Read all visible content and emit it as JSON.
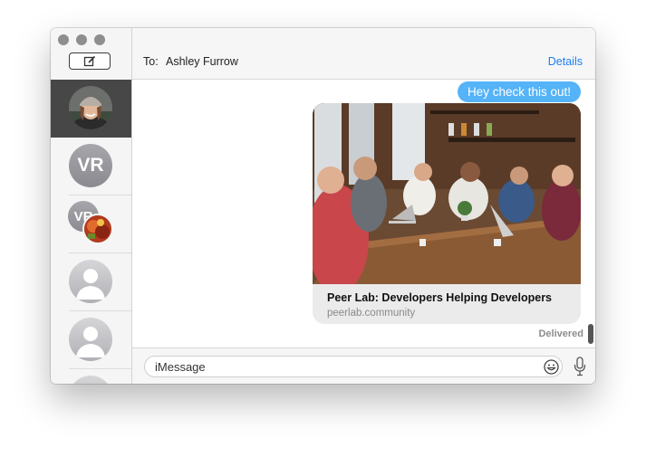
{
  "window": {
    "traffic_lights": [
      "close",
      "minimize",
      "zoom"
    ],
    "compose_icon": "compose-icon"
  },
  "sidebar": {
    "conversations": [
      {
        "type": "photo",
        "selected": true
      },
      {
        "type": "initials",
        "initials": "VR"
      },
      {
        "type": "group",
        "initials": "VR"
      },
      {
        "type": "placeholder"
      },
      {
        "type": "placeholder"
      },
      {
        "type": "placeholder"
      }
    ]
  },
  "header": {
    "to_label": "To:",
    "recipient": "Ashley Furrow",
    "details_label": "Details"
  },
  "transcript": {
    "message_text": "Hey check this out!",
    "link_preview": {
      "title": "Peer Lab: Developers Helping Developers",
      "domain": "peerlab.community"
    },
    "status": "Delivered"
  },
  "input": {
    "placeholder": "iMessage",
    "emoji_icon": "emoji-icon",
    "mic_icon": "microphone-icon"
  },
  "colors": {
    "bubble": "#55b3f8",
    "link": "#1c7ef0",
    "sidebar_selected": "#474747"
  }
}
